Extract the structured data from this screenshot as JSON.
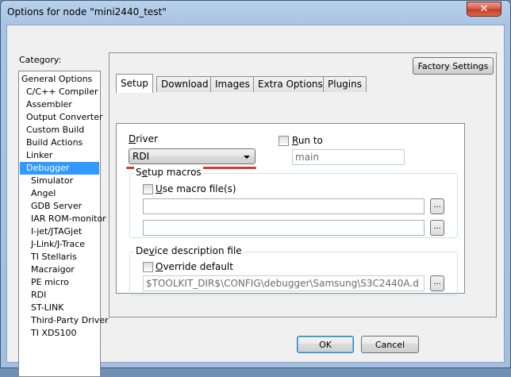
{
  "window": {
    "title": "Options for node \"mini2440_test\"",
    "close_symbol": "✕"
  },
  "category": {
    "label": "Category:",
    "selected_index": 6,
    "items": [
      "General Options",
      "C/C++ Compiler",
      "Assembler",
      "Output Converter",
      "Custom Build",
      "Build Actions",
      "Linker",
      "Debugger",
      "Simulator",
      "Angel",
      "GDB Server",
      "IAR ROM-monitor",
      "I-jet/JTAGjet",
      "J-Link/J-Trace",
      "TI Stellaris",
      "Macraigor",
      "PE micro",
      "RDI",
      "ST-LINK",
      "Third-Party Driver",
      "TI XDS100"
    ]
  },
  "panel": {
    "factory_settings_label": "Factory Settings",
    "tabs": [
      "Setup",
      "Download",
      "Images",
      "Extra Options",
      "Plugins"
    ],
    "active_tab": "Setup"
  },
  "setup": {
    "driver_label": "Driver",
    "driver_value": "RDI",
    "run_to_label": "Run to",
    "run_to_checked": false,
    "run_to_value": "main",
    "setup_macros_title": "Setup macros",
    "use_macro_label": "Use macro file(s)",
    "use_macro_checked": false,
    "macro_file_1": "",
    "macro_file_2": "",
    "device_desc_title": "Device description file",
    "override_label": "Override default",
    "override_checked": false,
    "device_desc_path": "$TOOLKIT_DIR$\\CONFIG\\debugger\\Samsung\\S3C2440A.d",
    "browse_label": "..."
  },
  "buttons": {
    "ok": "OK",
    "cancel": "Cancel"
  }
}
